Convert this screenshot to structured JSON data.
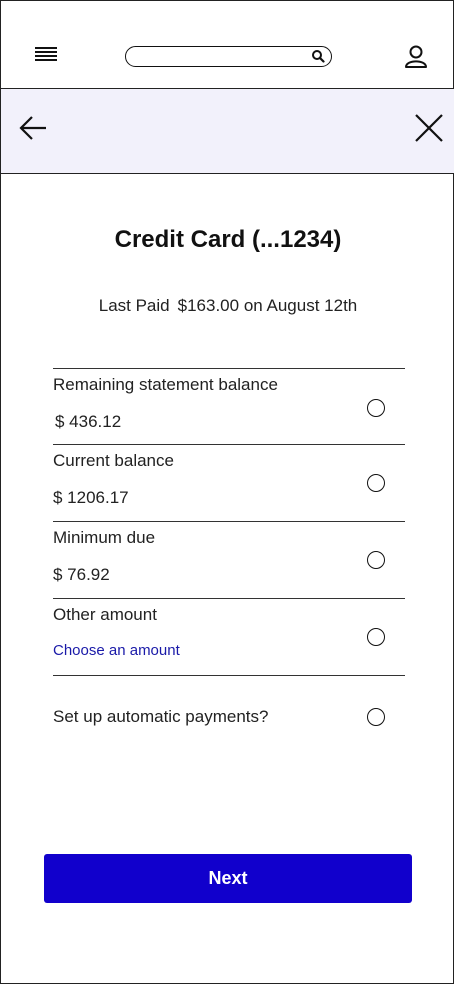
{
  "header": {
    "search": {
      "placeholder": "",
      "value": ""
    }
  },
  "main": {
    "title": "Credit Card (...1234)",
    "last_paid": {
      "label": "Last Paid",
      "amount": "$163.00",
      "date_text": "on August 12th"
    },
    "options": [
      {
        "label": "Remaining statement balance",
        "value": "$ 436.12",
        "selected": false
      },
      {
        "label": "Current balance",
        "value": "$ 1206.17",
        "selected": false
      },
      {
        "label": "Minimum due",
        "value": "$ 76.92",
        "selected": false
      },
      {
        "label": "Other amount",
        "link": "Choose an amount",
        "selected": false
      }
    ],
    "autopay": {
      "label": "Set up automatic payments?",
      "selected": false
    }
  },
  "footer": {
    "next_label": "Next"
  },
  "colors": {
    "accent": "#1100cc",
    "link": "#1a1aa8",
    "subheader_bg": "#f2f1fb"
  },
  "icons": [
    "hamburger-menu-icon",
    "search-icon",
    "user-profile-icon",
    "back-arrow-icon",
    "close-icon"
  ]
}
